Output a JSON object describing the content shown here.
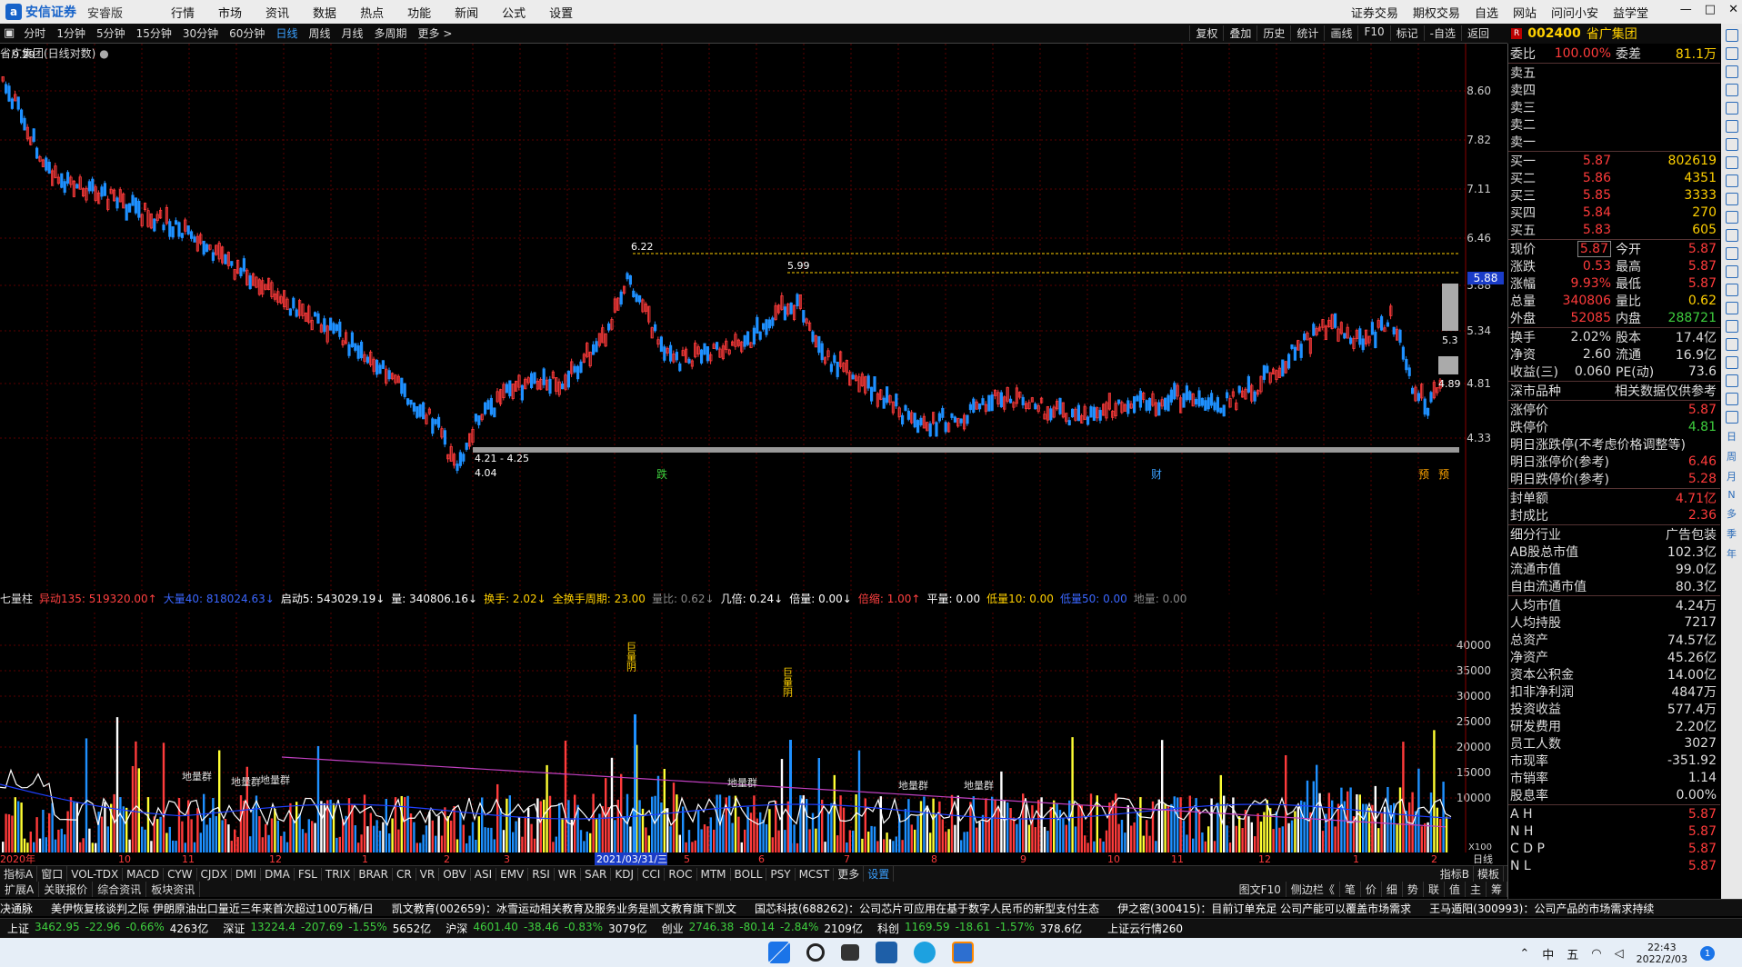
{
  "app": {
    "logo_text": "安信证券",
    "edition": "安睿版"
  },
  "menu": [
    "行情",
    "市场",
    "资讯",
    "数据",
    "热点",
    "功能",
    "新闻",
    "公式",
    "设置"
  ],
  "menu_right": [
    "证券交易",
    "期权交易",
    "自选",
    "网站",
    "问问小安",
    "益学堂"
  ],
  "window_buttons": [
    "—",
    "□",
    "✕"
  ],
  "periods": [
    "分时",
    "1分钟",
    "5分钟",
    "15分钟",
    "30分钟",
    "60分钟",
    "日线",
    "周线",
    "月线",
    "多周期",
    "更多 >"
  ],
  "active_period": "日线",
  "chart_tools": [
    "复权",
    "叠加",
    "历史",
    "统计",
    "画线",
    "F10",
    "标记",
    "-自选",
    "返回"
  ],
  "stock": {
    "code": "002400",
    "name": "省广集团",
    "badge": "R"
  },
  "chart_title": "省广集团(日线对数)",
  "price_axis": [
    "8.60",
    "7.82",
    "7.11",
    "6.46",
    "5.88",
    "5.34",
    "4.81",
    "4.33"
  ],
  "current_price_tag": "5.88",
  "annotations": {
    "high1": "6.22",
    "high2": "5.99",
    "range": "4.21 - 4.25",
    "low": "4.04",
    "left_top": "9.29",
    "right1": "5.3",
    "right2": "4.89"
  },
  "event_marks": {
    "e1": "跌",
    "e2": "财",
    "e3": "预",
    "e4": "预"
  },
  "volume_title": {
    "name": "七量柱",
    "items": [
      {
        "t": "异动135: 519320.00↑",
        "c": "#ff4040"
      },
      {
        "t": "大量40: 818024.63↓",
        "c": "#3a66ff"
      },
      {
        "t": "启动5: 543029.19↓",
        "c": "#ffffff"
      },
      {
        "t": "量: 340806.16↓",
        "c": "#ffffff"
      },
      {
        "t": "换手: 2.02↓",
        "c": "#ffd000"
      },
      {
        "t": "全换手周期: 23.00",
        "c": "#ffd000"
      },
      {
        "t": "量比: 0.62↓",
        "c": "#888888"
      },
      {
        "t": "几倍: 0.24↓",
        "c": "#ffffff"
      },
      {
        "t": "倍量: 0.00↓",
        "c": "#ffffff"
      },
      {
        "t": "倍缩: 1.00↑",
        "c": "#ff4040"
      },
      {
        "t": "平量: 0.00",
        "c": "#ffffff"
      },
      {
        "t": "低量10: 0.00",
        "c": "#ffd000"
      },
      {
        "t": "低量50: 0.00",
        "c": "#3a66ff"
      },
      {
        "t": "地量: 0.00",
        "c": "#888888"
      }
    ]
  },
  "volume_axis": [
    "40000",
    "35000",
    "30000",
    "25000",
    "20000",
    "15000",
    "10000"
  ],
  "volume_unit": "X100",
  "volume_labels": {
    "big1": "巨量阴",
    "big2": "巨量阴",
    "ground": "地量群"
  },
  "x_axis": {
    "start": "2020年",
    "date_hl": "2021/03/31/三",
    "months": [
      "10",
      "11",
      "12",
      "1",
      "2",
      "3",
      "5",
      "6",
      "7",
      "8",
      "9",
      "10",
      "11",
      "12",
      "1",
      "2"
    ],
    "right_label": "日线"
  },
  "indicator_tabs": [
    "指标A",
    "窗口",
    "VOL-TDX",
    "MACD",
    "CYW",
    "CJDX",
    "DMI",
    "DMA",
    "FSL",
    "TRIX",
    "BRAR",
    "CR",
    "VR",
    "OBV",
    "ASI",
    "EMV",
    "RSI",
    "WR",
    "SAR",
    "KDJ",
    "CCI",
    "ROC",
    "MTM",
    "BOLL",
    "PSY",
    "MCST",
    "更多",
    "设置"
  ],
  "indicator_right": [
    "指标B",
    "模板"
  ],
  "sub_tabs": [
    "扩展A",
    "关联报价",
    "综合资讯",
    "板块资讯"
  ],
  "sub_right": [
    "图文F10",
    "侧边栏《",
    "笔",
    "价",
    "细",
    "势",
    "联",
    "值",
    "主",
    "筹"
  ],
  "ticker": [
    "决通脉",
    "美伊恢复核谈判之际 伊朗原油出口量近三年来首次超过100万桶/日",
    "凯文教育(002659)：冰雪运动相关教育及服务业务是凯文教育旗下凯文",
    "国芯科技(688262)：公司芯片可应用在基于数字人民币的新型支付生态",
    "伊之密(300415)：目前订单充足 公司产能可以覆盖市场需求",
    "王马遁阳(300993)：公司产品的市场需求持续"
  ],
  "indexes": [
    {
      "name": "上证",
      "val": "3462.95",
      "chg": "-22.96",
      "pct": "-0.66%",
      "amt": "4263亿"
    },
    {
      "name": "深证",
      "val": "13224.4",
      "chg": "-207.69",
      "pct": "-1.55%",
      "amt": "5652亿"
    },
    {
      "name": "沪深",
      "val": "4601.40",
      "chg": "-38.46",
      "pct": "-0.83%",
      "amt": "3079亿"
    },
    {
      "name": "创业",
      "val": "2746.38",
      "chg": "-80.14",
      "pct": "-2.84%",
      "amt": "2109亿"
    },
    {
      "name": "科创",
      "val": "1169.59",
      "chg": "-18.61",
      "pct": "-1.57%",
      "amt": "378.6亿"
    }
  ],
  "index_extra": "上证云行情260",
  "quote_panel": {
    "ratio": {
      "l1": "委比",
      "v1": "100.00%",
      "l2": "委差",
      "v2": "81.1万"
    },
    "sell": [
      {
        "l": "卖五"
      },
      {
        "l": "卖四"
      },
      {
        "l": "卖三"
      },
      {
        "l": "卖二"
      },
      {
        "l": "卖一"
      }
    ],
    "buy": [
      {
        "l": "买一",
        "p": "5.87",
        "v": "802619"
      },
      {
        "l": "买二",
        "p": "5.86",
        "v": "4351"
      },
      {
        "l": "买三",
        "p": "5.85",
        "v": "3333"
      },
      {
        "l": "买四",
        "p": "5.84",
        "v": "270"
      },
      {
        "l": "买五",
        "p": "5.83",
        "v": "605"
      }
    ],
    "stats": [
      {
        "l1": "现价",
        "v1": "5.87",
        "l2": "今开",
        "v2": "5.87"
      },
      {
        "l1": "涨跌",
        "v1": "0.53",
        "l2": "最高",
        "v2": "5.87"
      },
      {
        "l1": "涨幅",
        "v1": "9.93%",
        "l2": "最低",
        "v2": "5.87"
      },
      {
        "l1": "总量",
        "v1": "340806",
        "l2": "量比",
        "v2": "0.62"
      },
      {
        "l1": "外盘",
        "v1": "52085",
        "l2": "内盘",
        "v2": "288721"
      }
    ],
    "stats2": [
      {
        "l1": "换手",
        "v1": "2.02%",
        "l2": "股本",
        "v2": "17.4亿"
      },
      {
        "l1": "净资",
        "v1": "2.60",
        "l2": "流通",
        "v2": "16.9亿"
      },
      {
        "l1": "收益(三)",
        "v1": "0.060",
        "l2": "PE(动)",
        "v2": "73.6"
      }
    ],
    "market": {
      "l": "深市品种",
      "r": "相关数据仅供参考"
    },
    "limits": [
      {
        "l": "涨停价",
        "v": "5.87"
      },
      {
        "l": "跌停价",
        "v": "4.81"
      },
      {
        "l": "明日涨跌停(不考虑价格调整等)",
        "v": ""
      },
      {
        "l": "明日涨停价(参考)",
        "v": "6.46"
      },
      {
        "l": "明日跌停价(参考)",
        "v": "5.28"
      }
    ],
    "seal": [
      {
        "l": "封单额",
        "v": "4.71亿"
      },
      {
        "l": "封成比",
        "v": "2.36"
      }
    ],
    "fund": [
      {
        "l": "细分行业",
        "v": "广告包装"
      },
      {
        "l": "AB股总市值",
        "v": "102.3亿"
      },
      {
        "l": "流通市值",
        "v": "99.0亿"
      },
      {
        "l": "自由流通市值",
        "v": "80.3亿"
      }
    ],
    "fin": [
      {
        "l": "人均市值",
        "v": "4.24万"
      },
      {
        "l": "人均持股",
        "v": "7217"
      },
      {
        "l": "总资产",
        "v": "74.57亿"
      },
      {
        "l": "净资产",
        "v": "45.26亿"
      },
      {
        "l": "资本公积金",
        "v": "14.00亿"
      },
      {
        "l": "扣非净利润",
        "v": "4847万"
      },
      {
        "l": "投资收益",
        "v": "577.4万"
      },
      {
        "l": "研发费用",
        "v": "2.20亿"
      },
      {
        "l": "员工人数",
        "v": "3027"
      },
      {
        "l": "市现率",
        "v": "-351.92"
      },
      {
        "l": "市销率",
        "v": "1.14"
      },
      {
        "l": "股息率",
        "v": "0.00%"
      }
    ],
    "markets": [
      {
        "l": "A H",
        "v": "5.87"
      },
      {
        "l": "N H",
        "v": "5.87"
      },
      {
        "l": "C D P",
        "v": "5.87"
      },
      {
        "l": "N L",
        "v": "5.87"
      }
    ]
  },
  "side_tools": [
    "日",
    "周",
    "月",
    "N",
    "多",
    "季",
    "年"
  ],
  "clock": {
    "time": "22:43",
    "date": "2022/2/03"
  },
  "tray": [
    "中",
    "五"
  ],
  "colors": {
    "up": "#ff3b3b",
    "down": "#1e90ff",
    "yellow": "#ffd000",
    "grid": "#5a0000"
  }
}
